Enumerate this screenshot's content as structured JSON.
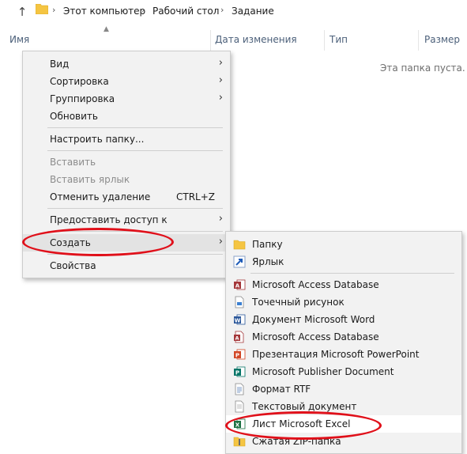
{
  "breadcrumb": {
    "up_arrow": "↑",
    "items": [
      "Этот компьютер",
      "Рабочий стол",
      "Задание"
    ]
  },
  "columns": {
    "name": "Имя",
    "date": "Дата изменения",
    "type": "Тип",
    "size": "Размер"
  },
  "empty_message": "Эта папка пуста.",
  "context_menu": {
    "items": [
      {
        "label": "Вид",
        "submenu": true
      },
      {
        "label": "Сортировка",
        "submenu": true
      },
      {
        "label": "Группировка",
        "submenu": true
      },
      {
        "label": "Обновить"
      },
      {
        "label": "Настроить папку..."
      },
      {
        "label": "Вставить",
        "disabled": true
      },
      {
        "label": "Вставить ярлык",
        "disabled": true
      },
      {
        "label": "Отменить удаление",
        "shortcut": "CTRL+Z"
      },
      {
        "label": "Предоставить доступ к",
        "submenu": true
      },
      {
        "label": "Создать",
        "submenu": true,
        "highlighted": true
      },
      {
        "label": "Свойства"
      }
    ]
  },
  "create_submenu": {
    "items": [
      {
        "label": "Папку",
        "icon": "folder-icon"
      },
      {
        "label": "Ярлык",
        "icon": "shortcut-icon"
      },
      {
        "label": "Microsoft Access Database",
        "icon": "access-icon"
      },
      {
        "label": "Точечный рисунок",
        "icon": "bitmap-icon"
      },
      {
        "label": "Документ Microsoft Word",
        "icon": "word-icon"
      },
      {
        "label": "Microsoft Access Database",
        "icon": "access-icon"
      },
      {
        "label": "Презентация Microsoft PowerPoint",
        "icon": "powerpoint-icon"
      },
      {
        "label": "Microsoft Publisher Document",
        "icon": "publisher-icon"
      },
      {
        "label": "Формат RTF",
        "icon": "rtf-icon"
      },
      {
        "label": "Текстовый документ",
        "icon": "text-document-icon"
      },
      {
        "label": "Лист Microsoft Excel",
        "icon": "excel-icon",
        "highlighted": true
      },
      {
        "label": "Сжатая ZIP-папка",
        "icon": "zip-folder-icon"
      }
    ]
  },
  "colors": {
    "annotation_ring": "#e0101a",
    "folder": "#f5c542",
    "excel": "#1f7244",
    "word": "#2b579a",
    "access": "#a4373a",
    "powerpoint": "#d24726",
    "publisher": "#077568"
  }
}
